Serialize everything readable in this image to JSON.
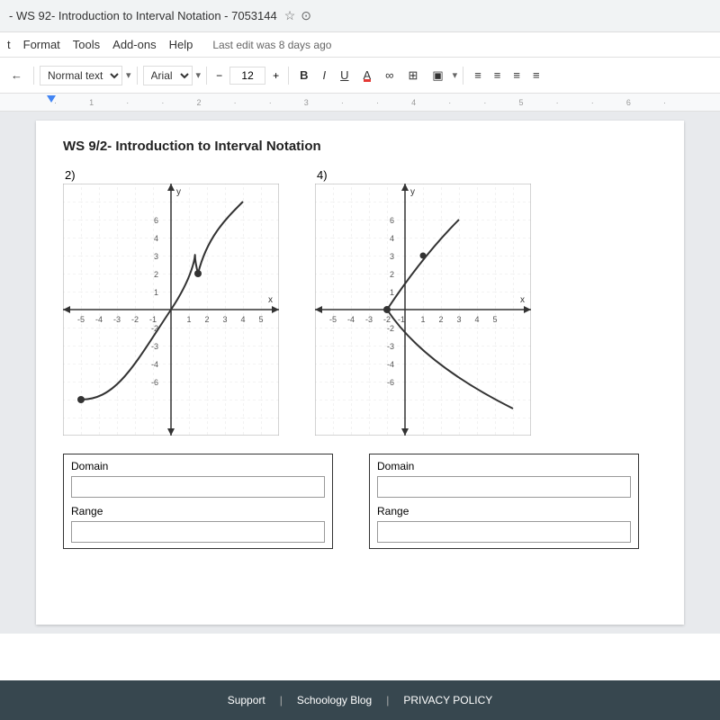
{
  "browser": {
    "title": "- WS 92- Introduction to Interval Notation - 7053144",
    "star": "☆",
    "icon": "⊙"
  },
  "menubar": {
    "items": [
      "t",
      "Format",
      "Tools",
      "Add-ons",
      "Help"
    ],
    "last_edit": "Last edit was 8 days ago"
  },
  "toolbar": {
    "arrow_left": "←",
    "normal_text_label": "Normal text",
    "font_label": "Arial",
    "font_size": "12",
    "bold": "B",
    "italic": "I",
    "underline": "U",
    "color_a": "A",
    "link_icon": "∞",
    "comment_icon": "⊞",
    "image_icon": "▣",
    "align1": "≡",
    "align2": "≡",
    "align3": "≡",
    "align4": "≡"
  },
  "ruler": {
    "marks": [
      "1",
      "2",
      "3",
      "4",
      "5",
      "6"
    ]
  },
  "document": {
    "title": "WS 9/2- Introduction to Interval Notation",
    "graph2_label": "2)",
    "graph4_label": "4)"
  },
  "answer_boxes": {
    "domain_label": "Domain",
    "range_label": "Range",
    "domain2_label": "Domain",
    "range2_label": "Range"
  },
  "footer": {
    "support": "Support",
    "sep1": "|",
    "blog": "Schoology Blog",
    "sep2": "|",
    "privacy": "PRIVACY POLICY"
  }
}
